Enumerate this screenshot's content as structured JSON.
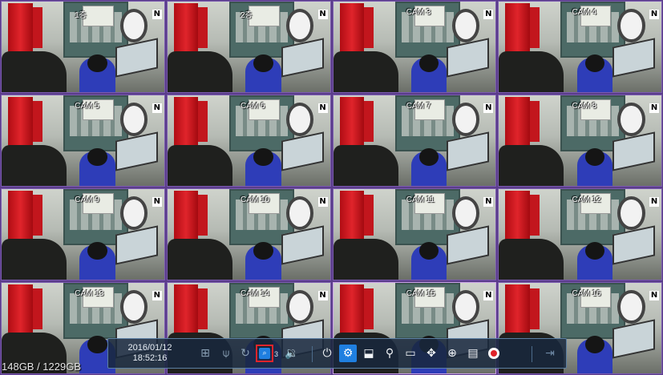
{
  "cameras": [
    {
      "label": "1층"
    },
    {
      "label": "2층"
    },
    {
      "label": "CAM 3"
    },
    {
      "label": "CAM 4"
    },
    {
      "label": "CAM 5"
    },
    {
      "label": "CAM 6"
    },
    {
      "label": "CAM 7"
    },
    {
      "label": "CAM 8"
    },
    {
      "label": "CAM 9"
    },
    {
      "label": "CAM 10"
    },
    {
      "label": "CAM 11"
    },
    {
      "label": "CAM 12"
    },
    {
      "label": "CAM 13"
    },
    {
      "label": "CAM 14"
    },
    {
      "label": "CAM 15"
    },
    {
      "label": "CAM 16"
    }
  ],
  "badge": "N",
  "storage": "148GB / 1229GB",
  "toolbar": {
    "date": "2016/01/12",
    "time": "18:52:16",
    "channel_count": "3",
    "icons": {
      "network": "network-icon",
      "usb": "usb-icon",
      "sync": "sync-icon",
      "search_channel": "search-channel-icon",
      "audio": "speaker-icon",
      "power": "power-icon",
      "settings": "gear-icon",
      "backup": "backup-icon",
      "search": "search-icon",
      "display": "monitor-icon",
      "ptz": "ptz-icon",
      "zoom": "zoom-icon",
      "log": "log-icon",
      "record": "record-icon",
      "logout": "logout-icon"
    }
  },
  "colors": {
    "accent": "#1f7fe0",
    "selected_border": "#e1242b",
    "record": "#e0232a"
  }
}
